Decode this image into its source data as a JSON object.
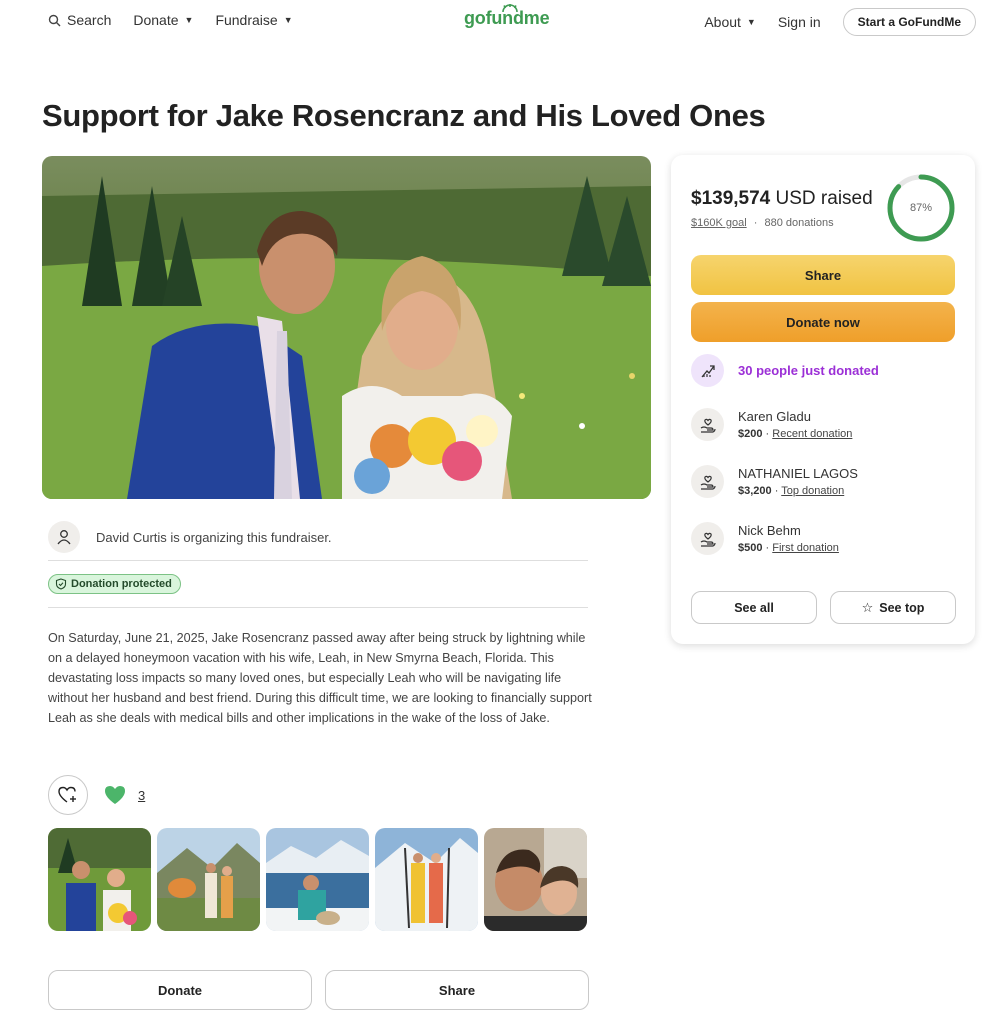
{
  "nav": {
    "search_label": "Search",
    "donate_label": "Donate",
    "fundraise_label": "Fundraise",
    "logo_text": "gofundme",
    "about_label": "About",
    "signin_label": "Sign in",
    "start_label": "Start a GoFundMe"
  },
  "campaign": {
    "title": "Support for Jake Rosencranz and His Loved Ones",
    "organizer_text": "David Curtis is organizing this fundraiser.",
    "protected_label": "Donation protected",
    "story": "On Saturday, June 21, 2025, Jake Rosencranz passed away after being struck by lightning while on a delayed honeymoon vacation with his wife, Leah, in New Smyrna Beach, Florida. This devastating loss impacts so many loved ones, but especially Leah who will be navigating life without her husband and best friend. During this difficult time, we are looking to financially support Leah as she deals with medical bills and other implications in the wake of the loss of Jake.",
    "heart_count": "3",
    "bottom_donate_label": "Donate",
    "bottom_share_label": "Share"
  },
  "progress": {
    "raised_amount": "$139,574",
    "raised_suffix": "USD raised",
    "goal": "$160K goal",
    "separator": "·",
    "donations": "880 donations",
    "percent_label": "87%",
    "percent_value": 0.87,
    "share_label": "Share",
    "donate_label": "Donate now",
    "trend_text": "30 people just donated",
    "see_all_label": "See all",
    "see_top_label": "See top"
  },
  "donors": [
    {
      "name": "Karen Gladu",
      "amount": "$200",
      "tag": "Recent donation"
    },
    {
      "name": "NATHANIEL LAGOS",
      "amount": "$3,200",
      "tag": "Top donation"
    },
    {
      "name": "Nick Behm",
      "amount": "$500",
      "tag": "First donation"
    }
  ],
  "colors": {
    "brand_green": "#3e9b52",
    "share_yellow": "#f1c342",
    "donate_orange": "#ef9f2a",
    "trend_purple": "#9b2fd6",
    "protected_bg": "#d9f5dc"
  }
}
